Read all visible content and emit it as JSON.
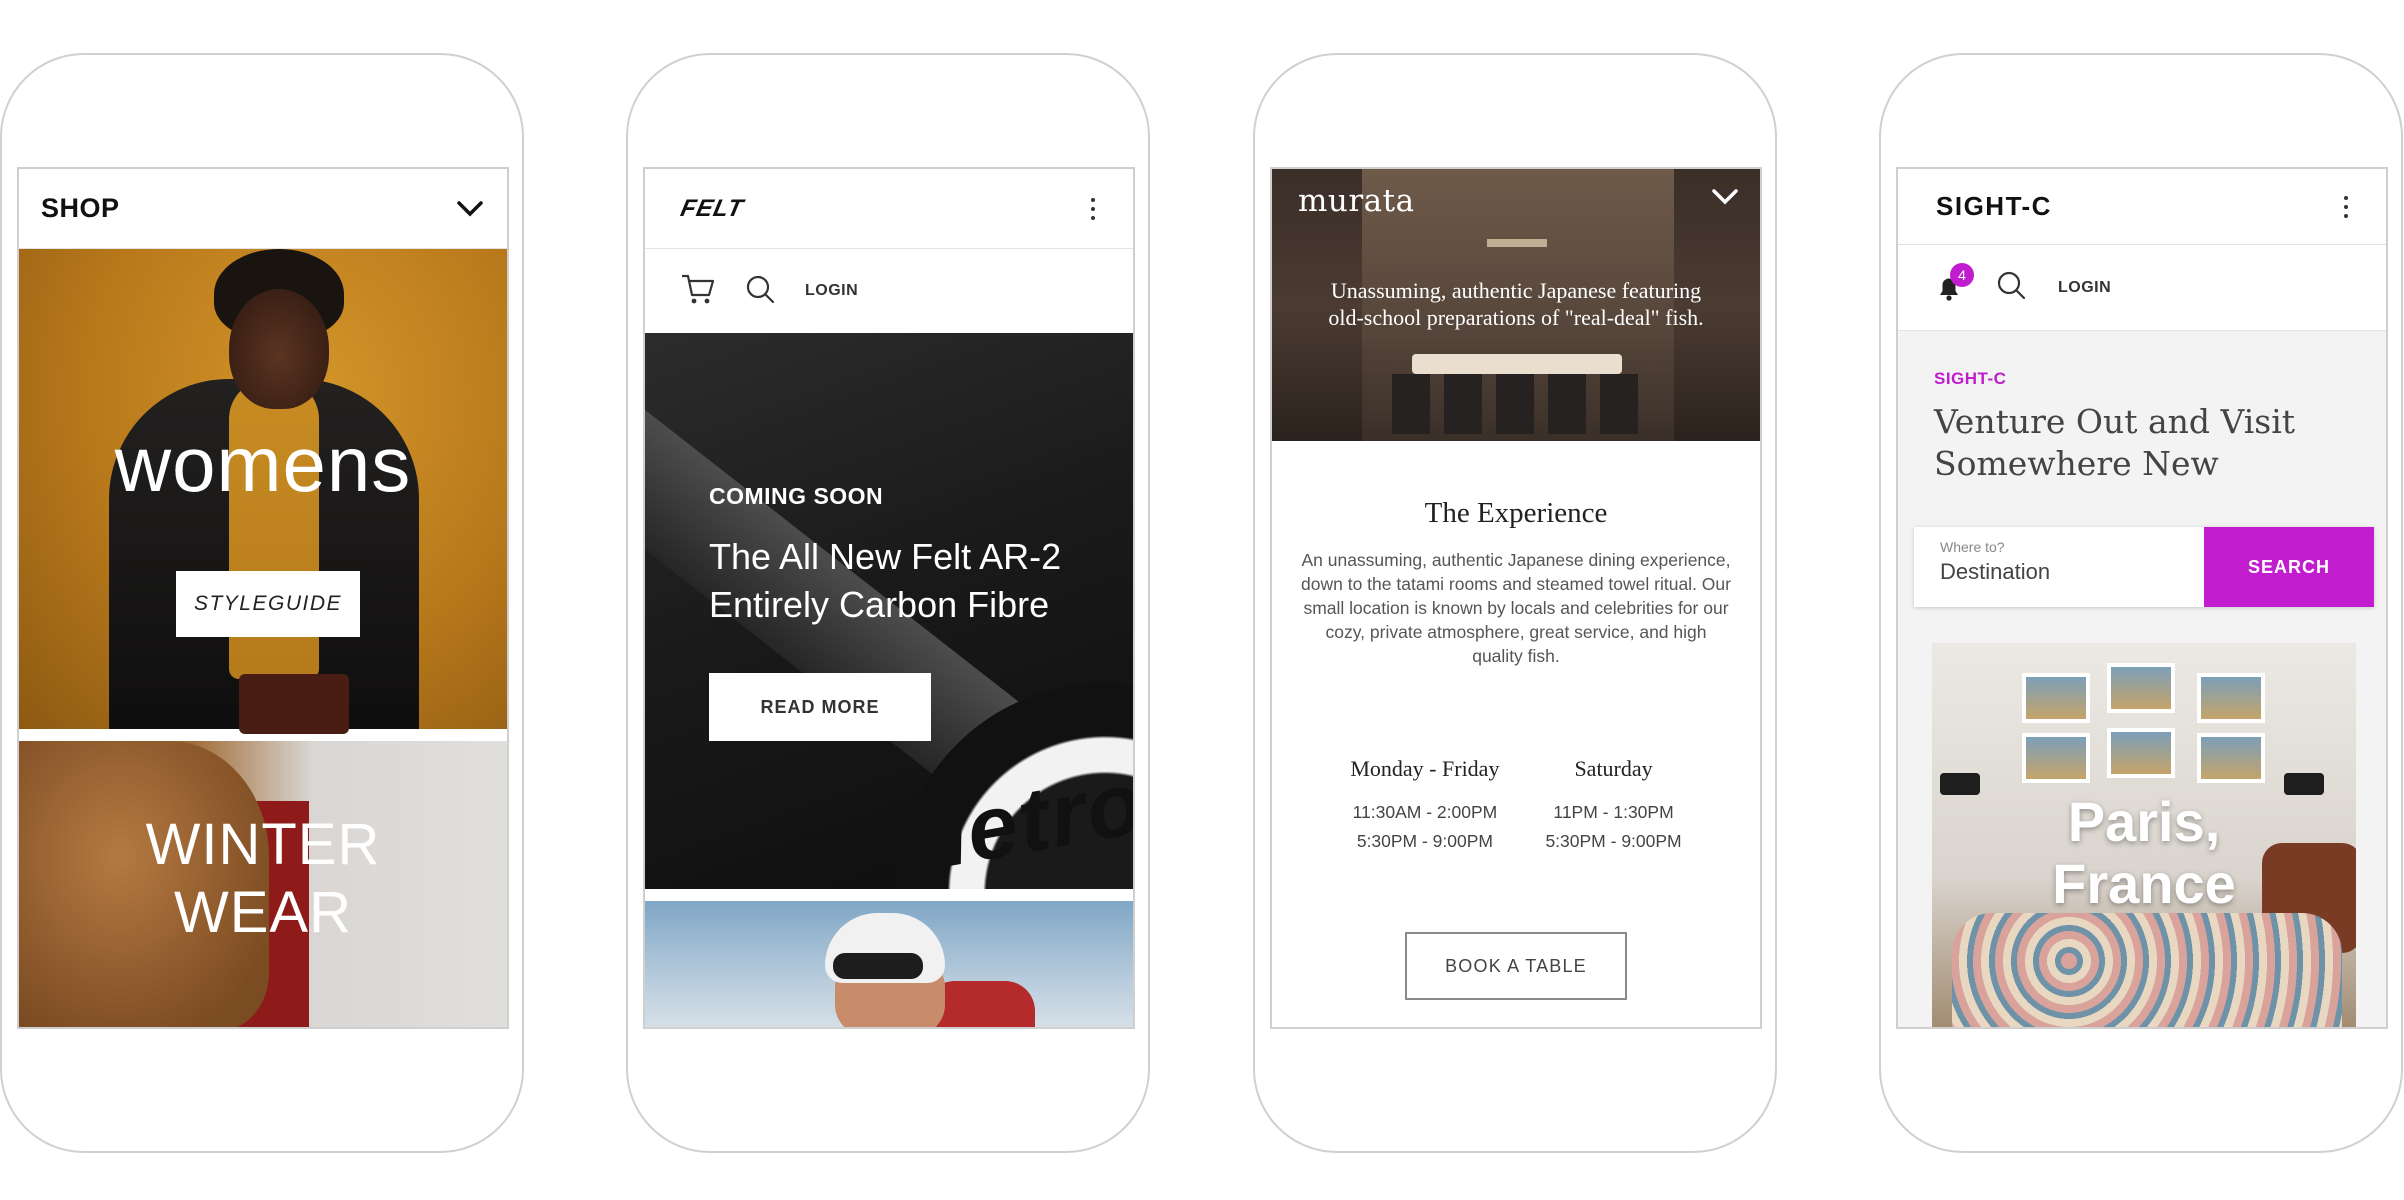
{
  "shop": {
    "title": "SHOP",
    "hero_title": "womens",
    "hero_button": "STYLEGUIDE",
    "secondary_title": "WINTER\nWEAR"
  },
  "felt": {
    "logo": "FELT",
    "login": "LOGIN",
    "eyebrow": "COMING SOON",
    "headline": "The All New Felt AR-2\nEntirely Carbon Fibre",
    "button": "READ MORE",
    "frame_text": "metro"
  },
  "murata": {
    "logo": "murata",
    "tagline": "Unassuming, authentic Japanese featuring\nold-school preparations of \"real-deal\" fish.",
    "section_title": "The Experience",
    "description": "An unassuming, authentic Japanese dining experience, down to the tatami rooms and steamed towel ritual. Our small location is known by locals and celebrities for our cozy, private atmosphere, great service, and high quality fish.",
    "hours": [
      {
        "day": "Monday - Friday",
        "times": [
          "11:30AM - 2:00PM",
          "5:30PM - 9:00PM"
        ]
      },
      {
        "day": "Saturday",
        "times": [
          "11PM - 1:30PM",
          "5:30PM - 9:00PM"
        ]
      }
    ],
    "button": "BOOK A TABLE"
  },
  "sightc": {
    "logo": "SIGHT-C",
    "notification_count": "4",
    "login": "LOGIN",
    "eyebrow": "SIGHT-C",
    "headline": "Venture Out and Visit\nSomewhere New",
    "field_label": "Where to?",
    "field_placeholder": "Destination",
    "search_button": "SEARCH",
    "card_title": "Paris,\nFrance",
    "accent_color": "#c21ccf"
  }
}
